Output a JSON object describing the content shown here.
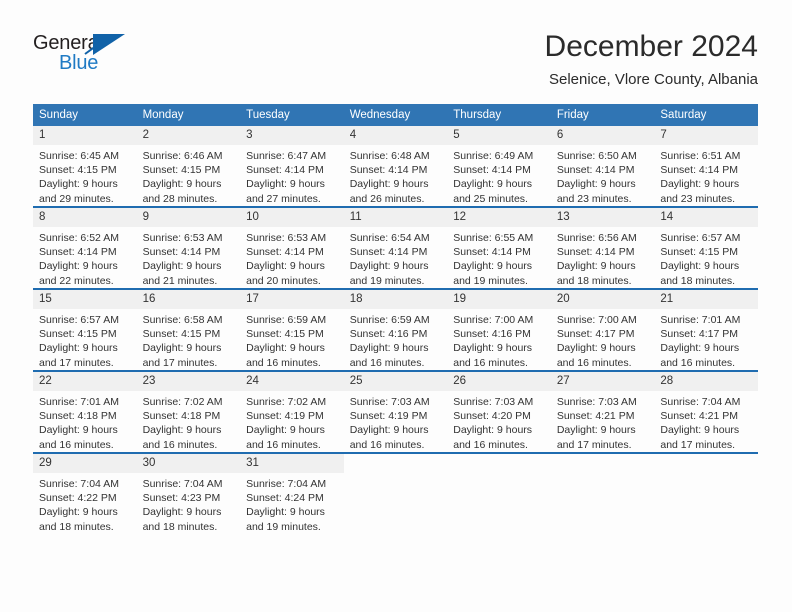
{
  "brand": {
    "name_part1": "General",
    "name_part2": "Blue"
  },
  "header": {
    "month_title": "December 2024",
    "location": "Selenice, Vlore County, Albania"
  },
  "colors": {
    "header_blue": "#3075b4",
    "row_divider_blue": "#1f6cb0",
    "daynum_band": "#f0f0f0",
    "logo_blue": "#1f7ac4",
    "page_background": "#fdfdfd",
    "text": "#333333"
  },
  "weekday_headers": [
    "Sunday",
    "Monday",
    "Tuesday",
    "Wednesday",
    "Thursday",
    "Friday",
    "Saturday"
  ],
  "labels": {
    "sunrise_prefix": "Sunrise:",
    "sunset_prefix": "Sunset:",
    "daylight_prefix": "Daylight:"
  },
  "weeks": [
    [
      {
        "day": "1",
        "sunrise": "Sunrise: 6:45 AM",
        "sunset": "Sunset: 4:15 PM",
        "daylight_line1": "Daylight: 9 hours",
        "daylight_line2": "and 29 minutes."
      },
      {
        "day": "2",
        "sunrise": "Sunrise: 6:46 AM",
        "sunset": "Sunset: 4:15 PM",
        "daylight_line1": "Daylight: 9 hours",
        "daylight_line2": "and 28 minutes."
      },
      {
        "day": "3",
        "sunrise": "Sunrise: 6:47 AM",
        "sunset": "Sunset: 4:14 PM",
        "daylight_line1": "Daylight: 9 hours",
        "daylight_line2": "and 27 minutes."
      },
      {
        "day": "4",
        "sunrise": "Sunrise: 6:48 AM",
        "sunset": "Sunset: 4:14 PM",
        "daylight_line1": "Daylight: 9 hours",
        "daylight_line2": "and 26 minutes."
      },
      {
        "day": "5",
        "sunrise": "Sunrise: 6:49 AM",
        "sunset": "Sunset: 4:14 PM",
        "daylight_line1": "Daylight: 9 hours",
        "daylight_line2": "and 25 minutes."
      },
      {
        "day": "6",
        "sunrise": "Sunrise: 6:50 AM",
        "sunset": "Sunset: 4:14 PM",
        "daylight_line1": "Daylight: 9 hours",
        "daylight_line2": "and 23 minutes."
      },
      {
        "day": "7",
        "sunrise": "Sunrise: 6:51 AM",
        "sunset": "Sunset: 4:14 PM",
        "daylight_line1": "Daylight: 9 hours",
        "daylight_line2": "and 23 minutes."
      }
    ],
    [
      {
        "day": "8",
        "sunrise": "Sunrise: 6:52 AM",
        "sunset": "Sunset: 4:14 PM",
        "daylight_line1": "Daylight: 9 hours",
        "daylight_line2": "and 22 minutes."
      },
      {
        "day": "9",
        "sunrise": "Sunrise: 6:53 AM",
        "sunset": "Sunset: 4:14 PM",
        "daylight_line1": "Daylight: 9 hours",
        "daylight_line2": "and 21 minutes."
      },
      {
        "day": "10",
        "sunrise": "Sunrise: 6:53 AM",
        "sunset": "Sunset: 4:14 PM",
        "daylight_line1": "Daylight: 9 hours",
        "daylight_line2": "and 20 minutes."
      },
      {
        "day": "11",
        "sunrise": "Sunrise: 6:54 AM",
        "sunset": "Sunset: 4:14 PM",
        "daylight_line1": "Daylight: 9 hours",
        "daylight_line2": "and 19 minutes."
      },
      {
        "day": "12",
        "sunrise": "Sunrise: 6:55 AM",
        "sunset": "Sunset: 4:14 PM",
        "daylight_line1": "Daylight: 9 hours",
        "daylight_line2": "and 19 minutes."
      },
      {
        "day": "13",
        "sunrise": "Sunrise: 6:56 AM",
        "sunset": "Sunset: 4:14 PM",
        "daylight_line1": "Daylight: 9 hours",
        "daylight_line2": "and 18 minutes."
      },
      {
        "day": "14",
        "sunrise": "Sunrise: 6:57 AM",
        "sunset": "Sunset: 4:15 PM",
        "daylight_line1": "Daylight: 9 hours",
        "daylight_line2": "and 18 minutes."
      }
    ],
    [
      {
        "day": "15",
        "sunrise": "Sunrise: 6:57 AM",
        "sunset": "Sunset: 4:15 PM",
        "daylight_line1": "Daylight: 9 hours",
        "daylight_line2": "and 17 minutes."
      },
      {
        "day": "16",
        "sunrise": "Sunrise: 6:58 AM",
        "sunset": "Sunset: 4:15 PM",
        "daylight_line1": "Daylight: 9 hours",
        "daylight_line2": "and 17 minutes."
      },
      {
        "day": "17",
        "sunrise": "Sunrise: 6:59 AM",
        "sunset": "Sunset: 4:15 PM",
        "daylight_line1": "Daylight: 9 hours",
        "daylight_line2": "and 16 minutes."
      },
      {
        "day": "18",
        "sunrise": "Sunrise: 6:59 AM",
        "sunset": "Sunset: 4:16 PM",
        "daylight_line1": "Daylight: 9 hours",
        "daylight_line2": "and 16 minutes."
      },
      {
        "day": "19",
        "sunrise": "Sunrise: 7:00 AM",
        "sunset": "Sunset: 4:16 PM",
        "daylight_line1": "Daylight: 9 hours",
        "daylight_line2": "and 16 minutes."
      },
      {
        "day": "20",
        "sunrise": "Sunrise: 7:00 AM",
        "sunset": "Sunset: 4:17 PM",
        "daylight_line1": "Daylight: 9 hours",
        "daylight_line2": "and 16 minutes."
      },
      {
        "day": "21",
        "sunrise": "Sunrise: 7:01 AM",
        "sunset": "Sunset: 4:17 PM",
        "daylight_line1": "Daylight: 9 hours",
        "daylight_line2": "and 16 minutes."
      }
    ],
    [
      {
        "day": "22",
        "sunrise": "Sunrise: 7:01 AM",
        "sunset": "Sunset: 4:18 PM",
        "daylight_line1": "Daylight: 9 hours",
        "daylight_line2": "and 16 minutes."
      },
      {
        "day": "23",
        "sunrise": "Sunrise: 7:02 AM",
        "sunset": "Sunset: 4:18 PM",
        "daylight_line1": "Daylight: 9 hours",
        "daylight_line2": "and 16 minutes."
      },
      {
        "day": "24",
        "sunrise": "Sunrise: 7:02 AM",
        "sunset": "Sunset: 4:19 PM",
        "daylight_line1": "Daylight: 9 hours",
        "daylight_line2": "and 16 minutes."
      },
      {
        "day": "25",
        "sunrise": "Sunrise: 7:03 AM",
        "sunset": "Sunset: 4:19 PM",
        "daylight_line1": "Daylight: 9 hours",
        "daylight_line2": "and 16 minutes."
      },
      {
        "day": "26",
        "sunrise": "Sunrise: 7:03 AM",
        "sunset": "Sunset: 4:20 PM",
        "daylight_line1": "Daylight: 9 hours",
        "daylight_line2": "and 16 minutes."
      },
      {
        "day": "27",
        "sunrise": "Sunrise: 7:03 AM",
        "sunset": "Sunset: 4:21 PM",
        "daylight_line1": "Daylight: 9 hours",
        "daylight_line2": "and 17 minutes."
      },
      {
        "day": "28",
        "sunrise": "Sunrise: 7:04 AM",
        "sunset": "Sunset: 4:21 PM",
        "daylight_line1": "Daylight: 9 hours",
        "daylight_line2": "and 17 minutes."
      }
    ],
    [
      {
        "day": "29",
        "sunrise": "Sunrise: 7:04 AM",
        "sunset": "Sunset: 4:22 PM",
        "daylight_line1": "Daylight: 9 hours",
        "daylight_line2": "and 18 minutes."
      },
      {
        "day": "30",
        "sunrise": "Sunrise: 7:04 AM",
        "sunset": "Sunset: 4:23 PM",
        "daylight_line1": "Daylight: 9 hours",
        "daylight_line2": "and 18 minutes."
      },
      {
        "day": "31",
        "sunrise": "Sunrise: 7:04 AM",
        "sunset": "Sunset: 4:24 PM",
        "daylight_line1": "Daylight: 9 hours",
        "daylight_line2": "and 19 minutes."
      },
      {
        "day": "",
        "sunrise": "",
        "sunset": "",
        "daylight_line1": "",
        "daylight_line2": ""
      },
      {
        "day": "",
        "sunrise": "",
        "sunset": "",
        "daylight_line1": "",
        "daylight_line2": ""
      },
      {
        "day": "",
        "sunrise": "",
        "sunset": "",
        "daylight_line1": "",
        "daylight_line2": ""
      },
      {
        "day": "",
        "sunrise": "",
        "sunset": "",
        "daylight_line1": "",
        "daylight_line2": ""
      }
    ]
  ]
}
